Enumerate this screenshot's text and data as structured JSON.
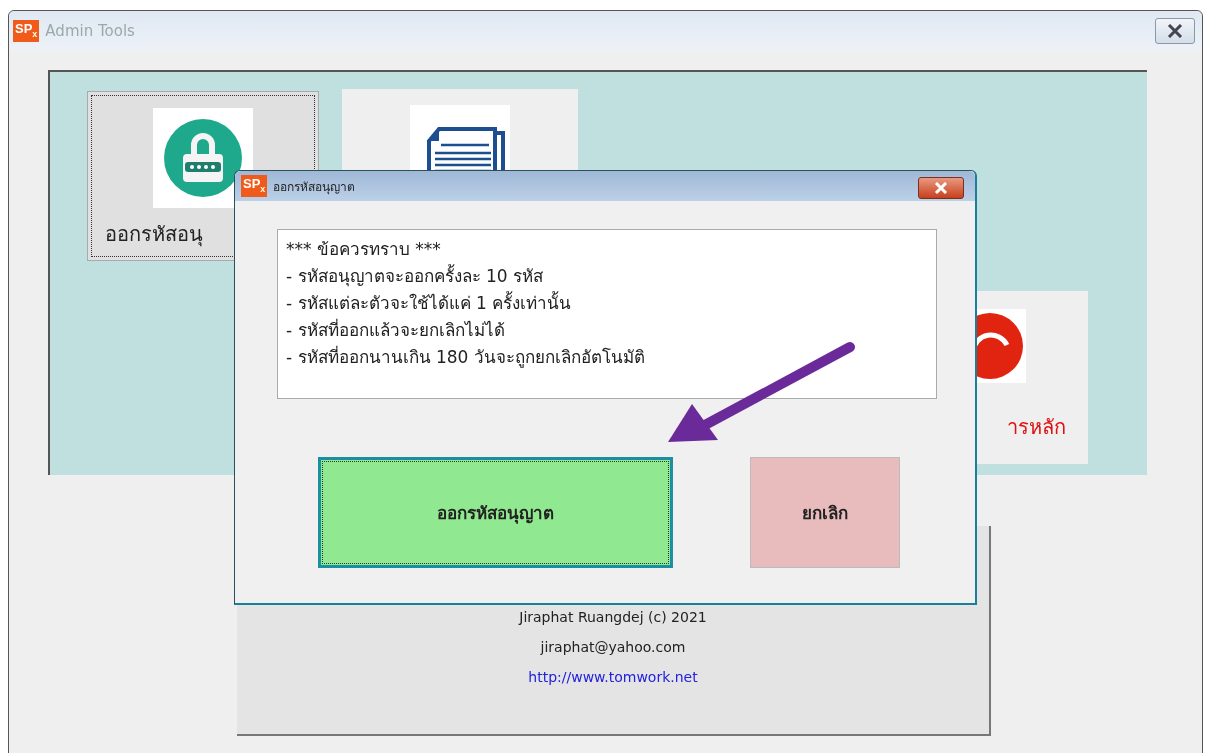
{
  "main_window": {
    "logo": "SP$_{x}$",
    "title": "Admin Tools",
    "tiles": [
      {
        "kind": "lock",
        "label": "ออกรหัสอนุ",
        "selected": true
      },
      {
        "kind": "report",
        "selected": false
      },
      {
        "kind": "exit",
        "label": "ารหลัก",
        "selected": false
      }
    ],
    "footer": {
      "author": "Jiraphat Ruangdej (c) 2021",
      "email": "jiraphat@yahoo.com",
      "website": "http://www.tomwork.net"
    }
  },
  "dialog": {
    "logo": "SP$_{x}$",
    "title": "ออกรหัสอนุญาต",
    "notice": [
      "*** ข้อควรทราบ ***",
      "- รหัสอนุญาตจะออกครั้งละ 10 รหัส",
      "- รหัสแต่ละตัวจะใช้ได้แค่ 1 ครั้งเท่านั้น",
      "- รหัสที่ออกแล้วจะยกเลิกไม่ได้",
      "- รหัสที่ออกนานเกิน 180 วันจะถูกยกเลิกอัตโนมัติ"
    ],
    "buttons": [
      {
        "kind": "confirm",
        "label": "ออกรหัสอนุญาต",
        "selected": true
      },
      {
        "kind": "cancel",
        "label": "ยกเลิก",
        "selected": false
      }
    ]
  }
}
